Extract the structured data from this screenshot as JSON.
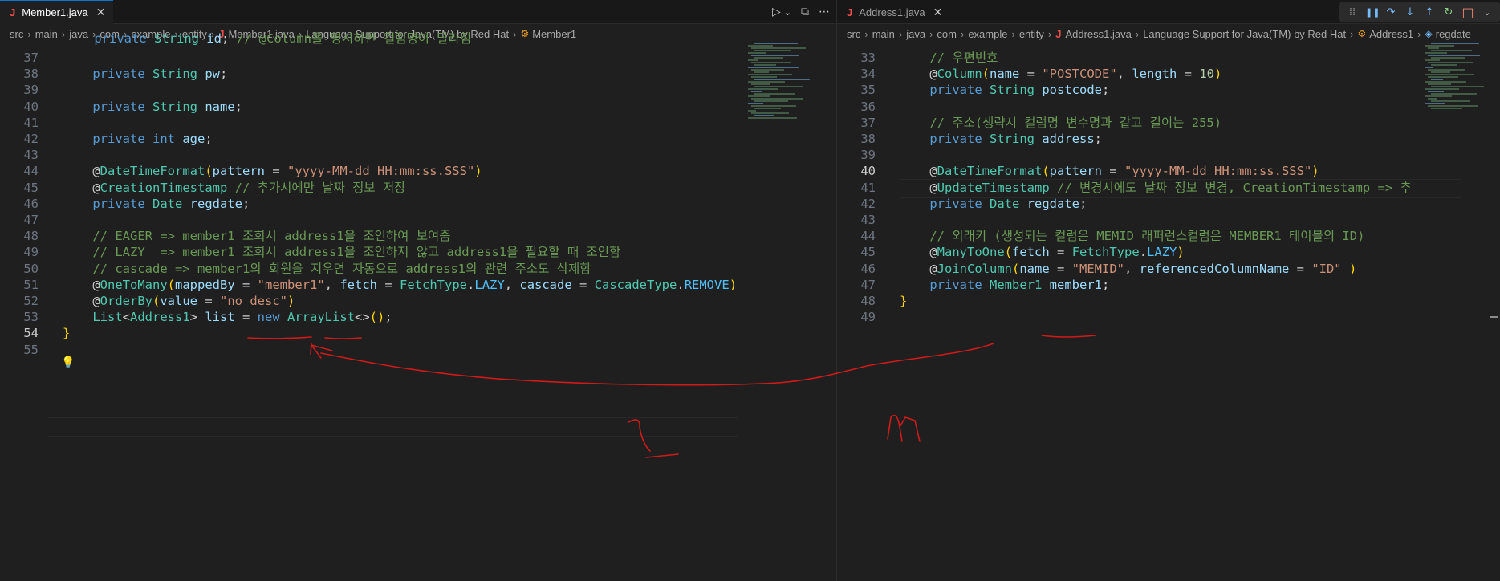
{
  "left": {
    "tab": {
      "label": "Member1.java",
      "close": "✕"
    },
    "actions": {
      "run": "▷",
      "run_menu": "⌄",
      "split": "⧉",
      "more": "⋯"
    },
    "breadcrumb": [
      "src",
      "main",
      "java",
      "com",
      "example",
      "entity",
      "Member1.java",
      "Language Support for Java(TM) by Red Hat",
      "Member1"
    ],
    "lines": [
      {
        "n": "37",
        "html": ""
      },
      {
        "n": "38",
        "html": "    <span class='k'>private</span> <span class='t'>String</span> <span class='v'>pw</span>;"
      },
      {
        "n": "39",
        "html": ""
      },
      {
        "n": "40",
        "html": "    <span class='k'>private</span> <span class='t'>String</span> <span class='v'>name</span>;"
      },
      {
        "n": "41",
        "html": ""
      },
      {
        "n": "42",
        "html": "    <span class='k'>private</span> <span class='k'>int</span> <span class='v'>age</span>;"
      },
      {
        "n": "43",
        "html": ""
      },
      {
        "n": "44",
        "html": "    @<span class='t'>DateTimeFormat</span><span class='p'>(</span><span class='v'>pattern</span> = <span class='s'>\"yyyy-MM-dd HH:mm:ss.SSS\"</span><span class='p'>)</span>"
      },
      {
        "n": "45",
        "html": "    @<span class='t'>CreationTimestamp</span> <span class='c'>// 추가시에만 날짜 정보 저장</span>"
      },
      {
        "n": "46",
        "html": "    <span class='k'>private</span> <span class='t'>Date</span> <span class='v'>regdate</span>;"
      },
      {
        "n": "47",
        "html": ""
      },
      {
        "n": "48",
        "html": "    <span class='c'>// EAGER =&gt; member1 조회시 address1을 조인하여 보여줌</span>"
      },
      {
        "n": "49",
        "html": "    <span class='c'>// LAZY  =&gt; member1 조회시 address1을 조인하지 않고 address1을 필요할 때 조인함</span>"
      },
      {
        "n": "50",
        "html": "    <span class='c'>// cascade =&gt; member1의 회원을 지우면 자동으로 address1의 관련 주소도 삭제함</span>"
      },
      {
        "n": "51",
        "html": "    @<span class='t'>OneToMany</span><span class='p'>(</span><span class='v'>mappedBy</span> = <span class='s'>\"member1\"</span>, <span class='v'>fetch</span> = <span class='t'>FetchType</span>.<span class='e'>LAZY</span>, <span class='v'>cascade</span> = <span class='t'>CascadeType</span>.<span class='e'>REMOVE</span><span class='p'>)</span>"
      },
      {
        "n": "52",
        "html": "    @<span class='t'>OrderBy</span><span class='p'>(</span><span class='v'>value</span> = <span class='s'>\"no desc\"</span><span class='p'>)</span>"
      },
      {
        "n": "53",
        "html": "    <span class='t'>List</span>&lt;<span class='t'>Address1</span>&gt; <span class='v'>list</span> = <span class='k'>new</span> <span class='t'>ArrayList</span>&lt;&gt;<span class='p'>()</span>;"
      },
      {
        "n": "54",
        "html": "<span class='p'>}</span>"
      },
      {
        "n": "55",
        "html": ""
      }
    ],
    "partial_top": "    <span class='k'>private</span> <span class='t'>String</span> <span class='v'>id</span>; <span class='c'>// @Column을 명시하면 컬럼명이 달라짐</span>"
  },
  "right": {
    "tab": {
      "label": "Address1.java",
      "close": "✕"
    },
    "debug": {
      "dots": "⁞⁞",
      "pause": "❚❚",
      "step_over": "↷",
      "step_into": "↓",
      "step_out": "↑",
      "restart": "↻",
      "stop": "□",
      "stop_menu": "⌄"
    },
    "breadcrumb": [
      "src",
      "main",
      "java",
      "com",
      "example",
      "entity",
      "Address1.java",
      "Language Support for Java(TM) by Red Hat",
      "Address1",
      "regdate"
    ],
    "lines": [
      {
        "n": "33",
        "html": "    <span class='c'>// 우편번호</span>"
      },
      {
        "n": "34",
        "html": "    @<span class='t'>Column</span><span class='p'>(</span><span class='v'>name</span> = <span class='s'>\"POSTCODE\"</span>, <span class='v'>length</span> = <span class='n'>10</span><span class='p'>)</span>"
      },
      {
        "n": "35",
        "html": "    <span class='k'>private</span> <span class='t'>String</span> <span class='v'>postcode</span>;"
      },
      {
        "n": "36",
        "html": ""
      },
      {
        "n": "37",
        "html": "    <span class='c'>// 주소(생략시 컬럼명 변수명과 같고 길이는 255)</span>"
      },
      {
        "n": "38",
        "html": "    <span class='k'>private</span> <span class='t'>String</span> <span class='v'>address</span>;"
      },
      {
        "n": "39",
        "html": ""
      },
      {
        "n": "40",
        "html": "    @<span class='t'>DateTimeFormat</span><span class='p'>(</span><span class='v'>pattern</span> = <span class='s'>\"yyyy-MM-dd HH:mm:ss.SSS\"</span><span class='p'>)</span>"
      },
      {
        "n": "41",
        "html": "    @<span class='t'>UpdateTimestamp</span> <span class='c'>// 변경시에도 날짜 정보 변경, CreationTimestamp =&gt; 추</span>"
      },
      {
        "n": "42",
        "html": "    <span class='k'>private</span> <span class='t'>Date</span> <span class='v'>regdate</span>;"
      },
      {
        "n": "43",
        "html": ""
      },
      {
        "n": "44",
        "html": "    <span class='c'>// 외래키 (생성되는 컬럼은 MEMID 래퍼런스컬럼은 MEMBER1 테이블의 ID)</span>"
      },
      {
        "n": "45",
        "html": "    @<span class='t'>ManyToOne</span><span class='p'>(</span><span class='v'>fetch</span> = <span class='t'>FetchType</span>.<span class='e'>LAZY</span><span class='p'>)</span>"
      },
      {
        "n": "46",
        "html": "    @<span class='t'>JoinColumn</span><span class='p'>(</span><span class='v'>name</span> = <span class='s'>\"MEMID\"</span>, <span class='v'>referencedColumnName</span> = <span class='s'>\"ID\"</span> <span class='p'>)</span>"
      },
      {
        "n": "47",
        "html": "    <span class='k'>private</span> <span class='t'>Member1</span> <span class='v'>member1</span>;"
      },
      {
        "n": "48",
        "html": "<span class='p'>}</span>"
      },
      {
        "n": "49",
        "html": ""
      }
    ]
  },
  "annotations": {
    "one": "1",
    "many": "n"
  },
  "colors": {
    "accent": "#0078d4",
    "annotation": "#d11a1a",
    "comment": "#6a9955"
  }
}
